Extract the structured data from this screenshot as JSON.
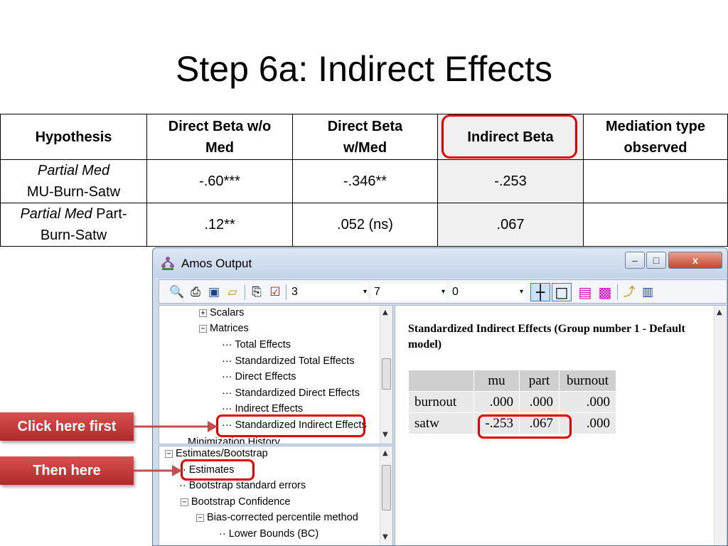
{
  "slide": {
    "title": "Step 6a: Indirect Effects"
  },
  "summary_table": {
    "headers": {
      "hypothesis": "Hypothesis",
      "direct_wo_med_line1": "Direct Beta w/o",
      "direct_wo_med_line2": "Med",
      "direct_w_med_line1": "Direct Beta",
      "direct_w_med_line2": "w/Med",
      "indirect": "Indirect Beta",
      "mediation_line1": "Mediation type",
      "mediation_line2": "observed"
    },
    "rows": [
      {
        "hyp_italic": "Partial Med",
        "hyp_rest": "MU-Burn-Satw",
        "direct_wo_med": "-.60***",
        "direct_w_med": "-.346**",
        "indirect": "-.253",
        "mediation": ""
      },
      {
        "hyp_italic": "Partial Med",
        "hyp_rest": " Part-",
        "hyp_line2": "Burn-Satw",
        "direct_wo_med": ".12**",
        "direct_w_med": ".052 (ns)",
        "indirect": ".067",
        "mediation": ""
      }
    ],
    "highlight_color": "#e00000"
  },
  "amos": {
    "window_title": "Amos Output",
    "controls": {
      "minimize": "–",
      "maximize": "□",
      "close": "x"
    },
    "toolbar": {
      "combo1": "3",
      "combo2": "7",
      "combo3": "0",
      "combo_arrow": "▾",
      "icons": [
        "print-preview-icon",
        "print-icon",
        "book-icon",
        "open-folder-icon",
        "copy-icon",
        "checkbox-icon",
        "table-lines-icon",
        "table-box-icon",
        "table-magenta-icon",
        "table-magenta-blue-icon",
        "help-pointer-icon",
        "book-open-icon"
      ]
    },
    "tree_top": {
      "scalars": "Scalars",
      "matrices": "Matrices",
      "total_effects": "Total Effects",
      "std_total_effects": "Standardized Total Effects",
      "direct_effects": "Direct Effects",
      "std_direct_effects": "Standardized Direct Effects",
      "indirect_effects": "Indirect Effects",
      "std_indirect_effects": "Standardized Indirect Effects",
      "minimization_history": "Minimization History"
    },
    "tree_bottom": {
      "estimates_bootstrap": "Estimates/Bootstrap",
      "estimates": "Estimates",
      "bootstrap_se": "Bootstrap standard errors",
      "bootstrap_confidence": "Bootstrap Confidence",
      "bias_corrected": "Bias-corrected percentile method",
      "lower_bounds": "Lower Bounds (BC)"
    },
    "output": {
      "heading": "Standardized Indirect Effects (Group number 1 - Default model)",
      "columns": [
        "mu",
        "part",
        "burnout"
      ],
      "rows": [
        {
          "label": "burnout",
          "values": [
            ".000",
            ".000",
            ".000"
          ]
        },
        {
          "label": "satw",
          "values": [
            "-.253",
            ".067",
            ".000"
          ]
        }
      ]
    }
  },
  "callouts": {
    "first": "Click here first",
    "then": "Then here",
    "color": "#c03535"
  }
}
